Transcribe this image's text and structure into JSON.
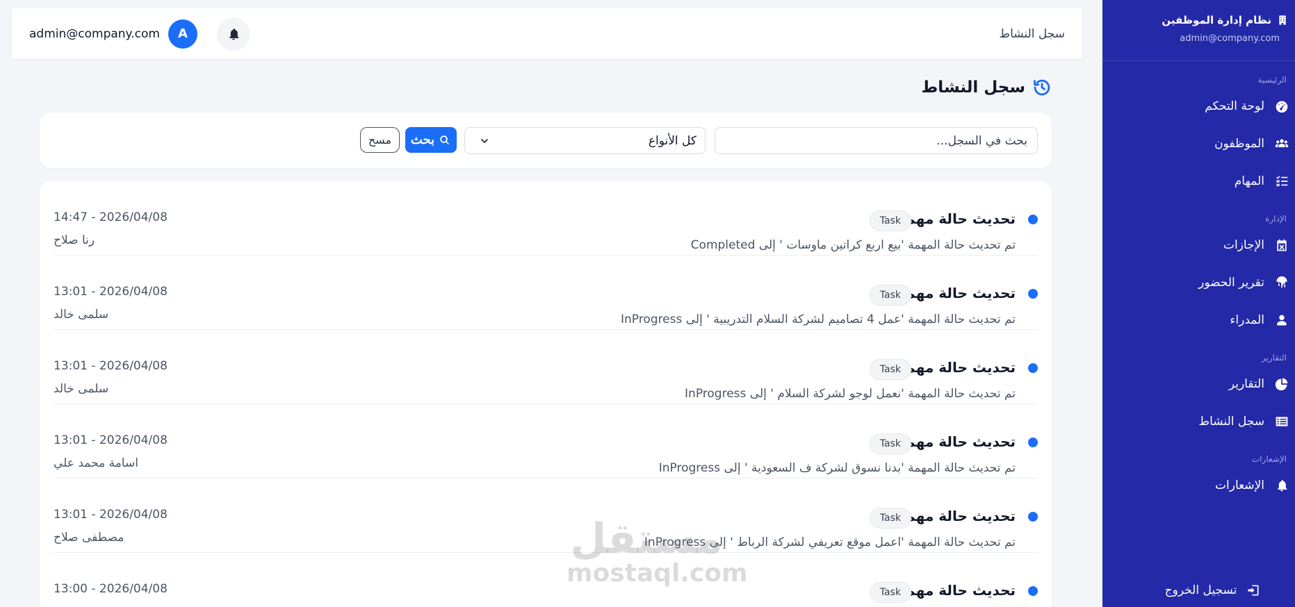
{
  "sidebar": {
    "brand_title": "نظام إدارة الموظفين",
    "brand_email": "admin@company.com",
    "section_main": "الرئيسية",
    "items_main": [
      {
        "label": "لوحة التحكم",
        "icon": "dashboard-icon"
      },
      {
        "label": "الموظفون",
        "icon": "users-icon"
      },
      {
        "label": "المهام",
        "icon": "tasks-icon"
      }
    ],
    "section_admin": "الإدارة",
    "items_admin": [
      {
        "label": "الإجازات",
        "icon": "calendar-x-icon"
      },
      {
        "label": "تقرير الحضور",
        "icon": "fingerprint-icon"
      },
      {
        "label": "المدراء",
        "icon": "user-icon"
      }
    ],
    "section_reports": "التقارير",
    "items_reports": [
      {
        "label": "التقارير",
        "icon": "pie-chart-icon"
      },
      {
        "label": "سجل النشاط",
        "icon": "list-icon"
      }
    ],
    "section_notifications": "الإشعارات",
    "items_notifications": [
      {
        "label": "الإشعارات",
        "icon": "bell-icon"
      }
    ],
    "logout_label": "تسجيل الخروج"
  },
  "header": {
    "email": "admin@company.com",
    "avatar_letter": "A",
    "title": "سجل النشاط"
  },
  "page": {
    "title": "سجل النشاط"
  },
  "filters": {
    "search_placeholder": "بحث في السجل...",
    "type_selected": "كل الأنواع",
    "search_button": "بحث",
    "clear_button": "مسح"
  },
  "activities": [
    {
      "title": "تحديث حالة مهمة",
      "badge": "Task",
      "description": "تم تحديث حالة المهمة 'بيع اربع كراتين ماوسات ' إلى Completed",
      "time": "14:47 - 2026/04/08",
      "user": "رنا صلاح"
    },
    {
      "title": "تحديث حالة مهمة",
      "badge": "Task",
      "description": "تم تحديث حالة المهمة 'عمل 4 تصاميم لشركة السلام التدريبية ' إلى InProgress",
      "time": "13:01 - 2026/04/08",
      "user": "سلمى خالد"
    },
    {
      "title": "تحديث حالة مهمة",
      "badge": "Task",
      "description": "تم تحديث حالة المهمة 'نعمل لوجو لشركة السلام ' إلى InProgress",
      "time": "13:01 - 2026/04/08",
      "user": "سلمى خالد"
    },
    {
      "title": "تحديث حالة مهمة",
      "badge": "Task",
      "description": "تم تحديث حالة المهمة 'بدنا نسوق لشركة ف السعودية ' إلى InProgress",
      "time": "13:01 - 2026/04/08",
      "user": "اسامة محمد علي"
    },
    {
      "title": "تحديث حالة مهمة",
      "badge": "Task",
      "description": "تم تحديث حالة المهمة 'اعمل موقع تعريفي لشركة الرباط ' إلى InProgress",
      "time": "13:01 - 2026/04/08",
      "user": "مصطفى صلاح"
    },
    {
      "title": "تحديث حالة مهمة",
      "badge": "Task",
      "description": "",
      "time": "13:00 - 2026/04/08",
      "user": ""
    }
  ],
  "watermark": {
    "arabic": "مستقل",
    "latin": "mostaql.com"
  }
}
